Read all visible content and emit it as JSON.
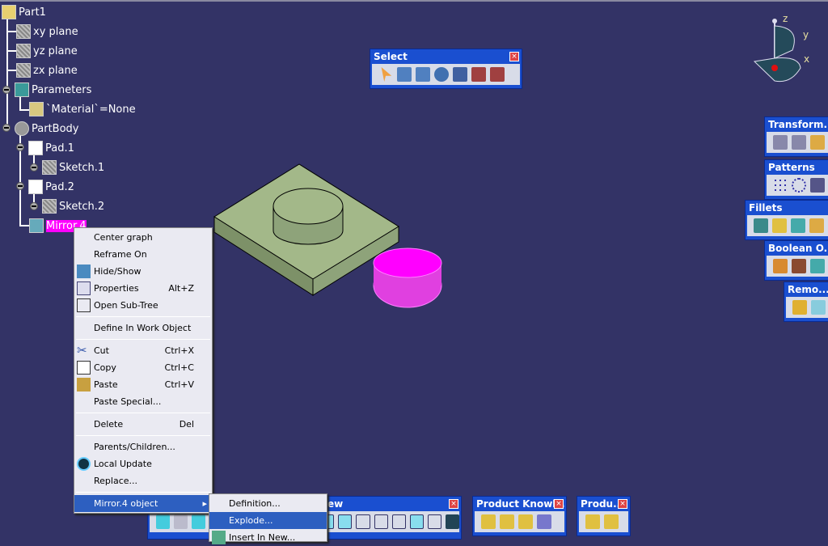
{
  "tree": {
    "root": "Part1",
    "items": [
      "xy plane",
      "yz plane",
      "zx plane",
      "Parameters",
      "`Material`=None",
      "PartBody",
      "Pad.1",
      "Sketch.1",
      "Pad.2",
      "Sketch.2",
      "Mirror.4"
    ]
  },
  "compass": {
    "z": "z",
    "y": "y",
    "x": "x"
  },
  "toolbars": {
    "select": "Select",
    "transform": "Transform...",
    "patterns": "Patterns",
    "fillets": "Fillets",
    "boolean": "Boolean O...",
    "remove": "Remo...",
    "view": "ew",
    "product_knowledge": "Product Knowl...",
    "product": "Produ...",
    "close": "×"
  },
  "context_menu": {
    "items": [
      {
        "label": "Center graph"
      },
      {
        "label": "Reframe On"
      },
      {
        "label": "Hide/Show"
      },
      {
        "label": "Properties",
        "shortcut": "Alt+Z"
      },
      {
        "label": "Open Sub-Tree"
      },
      {
        "label": "Define In Work Object"
      },
      {
        "label": "Cut",
        "shortcut": "Ctrl+X"
      },
      {
        "label": "Copy",
        "shortcut": "Ctrl+C"
      },
      {
        "label": "Paste",
        "shortcut": "Ctrl+V"
      },
      {
        "label": "Paste Special..."
      },
      {
        "label": "Delete",
        "shortcut": "Del"
      },
      {
        "label": "Parents/Children..."
      },
      {
        "label": "Local Update"
      },
      {
        "label": "Replace..."
      },
      {
        "label": "Mirror.4 object",
        "arrow": "▸"
      }
    ]
  },
  "submenu": {
    "items": [
      "Definition...",
      "Explode...",
      "Insert In New..."
    ]
  },
  "colors": {
    "background": "#333366",
    "model": "#a3b889",
    "highlight": "#ff00ff",
    "menu_highlight": "#2d5fc0"
  }
}
